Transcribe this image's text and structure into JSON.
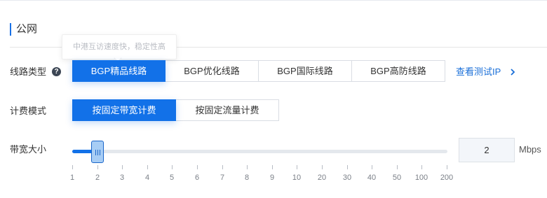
{
  "section": {
    "title": "公网"
  },
  "line_type": {
    "label": "线路类型",
    "help_icon": "?",
    "tooltip": "中港互访速度快，稳定性高",
    "options": [
      {
        "label": "BGP精品线路",
        "active": true
      },
      {
        "label": "BGP优化线路",
        "active": false
      },
      {
        "label": "BGP国际线路",
        "active": false
      },
      {
        "label": "BGP高防线路",
        "active": false
      }
    ],
    "test_ip_link": "查看测试IP"
  },
  "billing": {
    "label": "计费模式",
    "options": [
      {
        "label": "按固定带宽计费",
        "active": true
      },
      {
        "label": "按固定流量计费",
        "active": false
      }
    ]
  },
  "bandwidth": {
    "label": "带宽大小",
    "value": "2",
    "unit": "Mbps",
    "scale": [
      "1",
      "2",
      "3",
      "4",
      "5",
      "6",
      "7",
      "8",
      "9",
      "10",
      "20",
      "30",
      "40",
      "50",
      "100",
      "200"
    ],
    "selected_index": 1
  },
  "colors": {
    "accent": "#1271e8",
    "link": "#1a6fd8",
    "handle": "#a7cdf5"
  }
}
